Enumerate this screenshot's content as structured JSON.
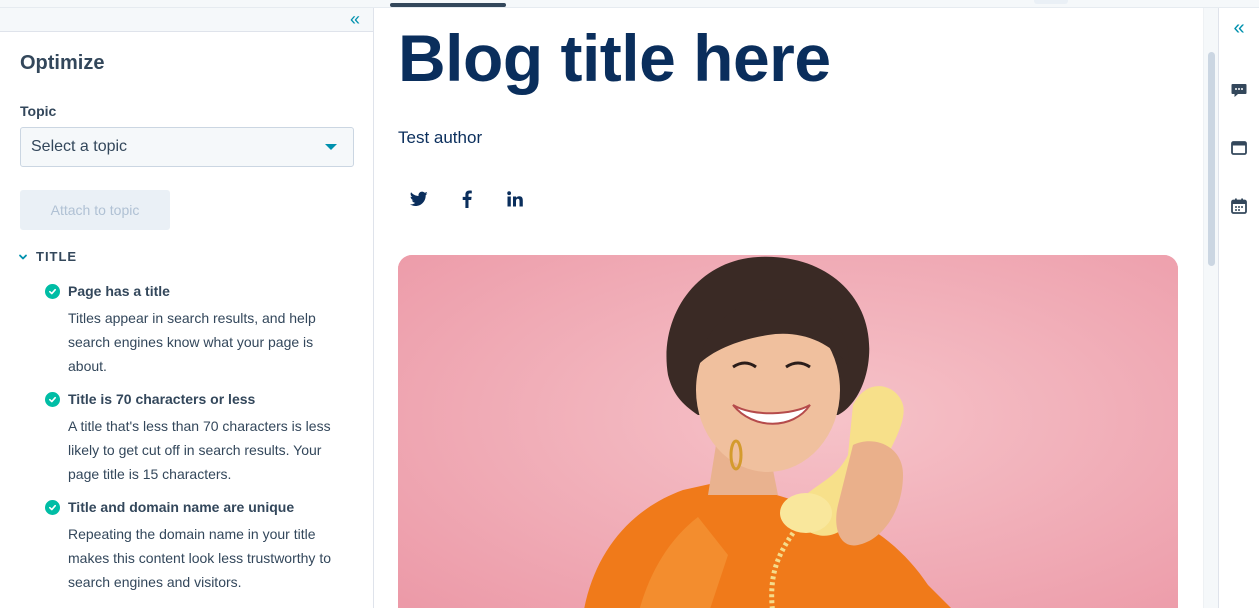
{
  "sidebar": {
    "collapse_icon": "double-chevron-left-icon",
    "title": "Optimize",
    "topic": {
      "label": "Topic",
      "select_value": "Select a topic"
    },
    "attach_button": "Attach to topic",
    "section": {
      "label": "TITLE",
      "checks": [
        {
          "title": "Page has a title",
          "description": "Titles appear in search results, and help search engines know what your page is about.",
          "status": "passed"
        },
        {
          "title": "Title is 70 characters or less",
          "description": "A title that's less than 70 characters is less likely to get cut off in search results. Your page title is 15 characters.",
          "status": "passed"
        },
        {
          "title": "Title and domain name are unique",
          "description": "Repeating the domain name in your title makes this content look less trustworthy to search engines and visitors.",
          "status": "passed"
        }
      ]
    }
  },
  "main": {
    "blog_title": "Blog title here",
    "author": "Test author",
    "social_icons": [
      "twitter-icon",
      "facebook-icon",
      "linkedin-icon"
    ],
    "hero_image": "woman-on-phone-image"
  },
  "right_rail": {
    "icons": [
      "double-chevron-left-icon",
      "comment-icon",
      "browser-window-icon",
      "calendar-icon"
    ]
  },
  "colors": {
    "accent": "#0091ae",
    "success": "#00bda5",
    "title": "#0a2e5c",
    "text": "#33475b",
    "hero_bg": "#f0a6b2"
  }
}
